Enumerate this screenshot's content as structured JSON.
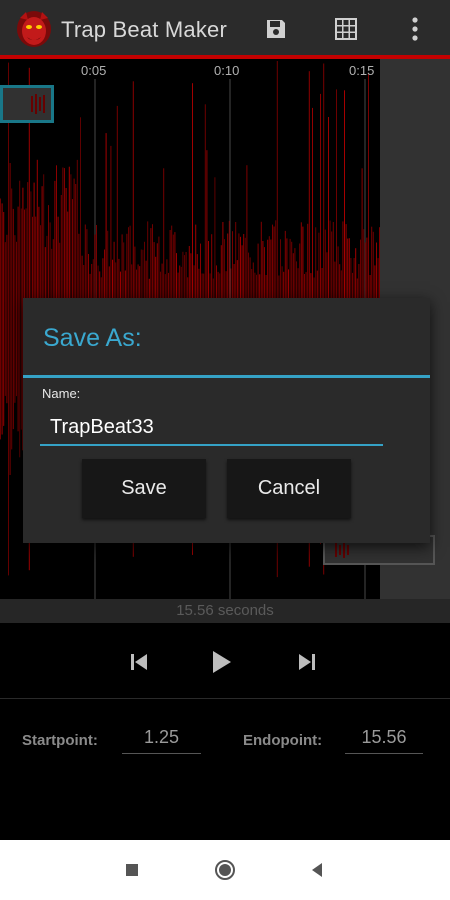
{
  "app": {
    "title": "Trap Beat Maker",
    "logo_icon": "red-demon-face-icon"
  },
  "toolbar": {
    "save_icon": "floppy-disk-icon",
    "grid_icon": "grid-icon",
    "menu_icon": "more-vert-icon"
  },
  "timeline": {
    "labels": [
      "0:05",
      "0:10",
      "0:15"
    ]
  },
  "waveform": {
    "color": "#c40000"
  },
  "duration": {
    "text": "15.56 seconds"
  },
  "transport": {
    "prev_icon": "skip-previous-icon",
    "play_icon": "play-icon",
    "next_icon": "skip-next-icon"
  },
  "points": {
    "start_label": "Startpoint:",
    "start_value": "1.25",
    "end_label": "Endopoint:",
    "end_value": "15.56"
  },
  "dialog": {
    "title": "Save As:",
    "name_label": "Name:",
    "name_value": "TrapBeat33",
    "save_label": "Save",
    "cancel_label": "Cancel"
  },
  "navbar": {
    "recents_icon": "square-recents-icon",
    "home_icon": "circle-home-icon",
    "back_icon": "triangle-back-icon"
  },
  "colors": {
    "accent": "#35a2c6",
    "toolbar_bg": "#2b2b2b",
    "brand_red": "#c40000"
  }
}
